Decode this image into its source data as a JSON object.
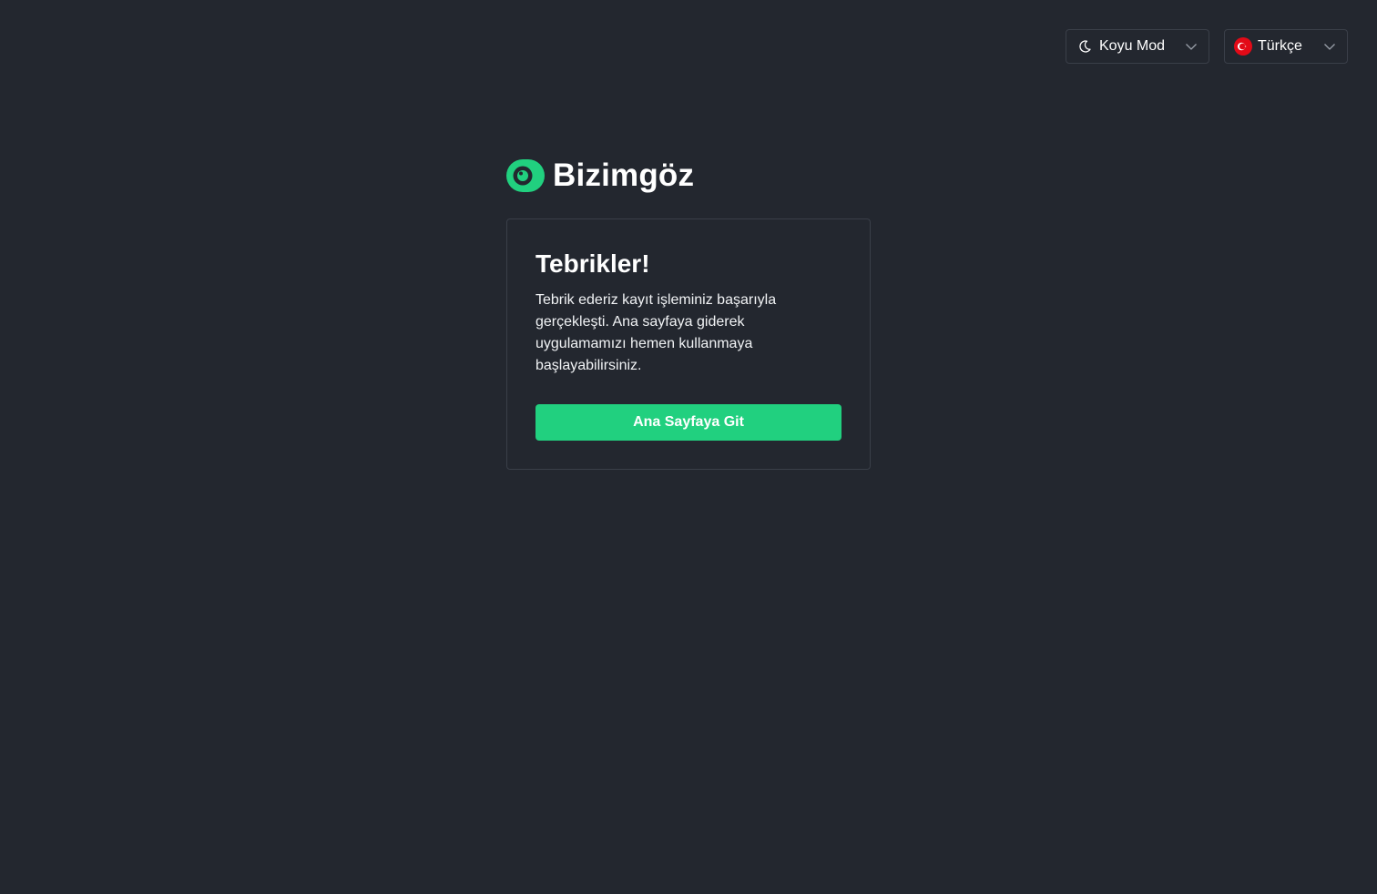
{
  "topbar": {
    "theme": {
      "label": "Koyu Mod",
      "icon": "moon-icon"
    },
    "language": {
      "label": "Türkçe",
      "icon": "turkey-flag-icon"
    }
  },
  "brand": {
    "name": "Bizimgöz",
    "accent": "#21d07f"
  },
  "card": {
    "title": "Tebrikler!",
    "message": "Tebrik ederiz kayıt işleminiz başarıyla gerçekleşti. Ana sayfaya giderek uygulamamızı hemen kullanmaya başlayabilirsiniz.",
    "button_label": "Ana Sayfaya Git"
  },
  "colors": {
    "background": "#23272f",
    "border": "#3a3f49",
    "button": "#21d07f",
    "text": "#ffffff"
  }
}
